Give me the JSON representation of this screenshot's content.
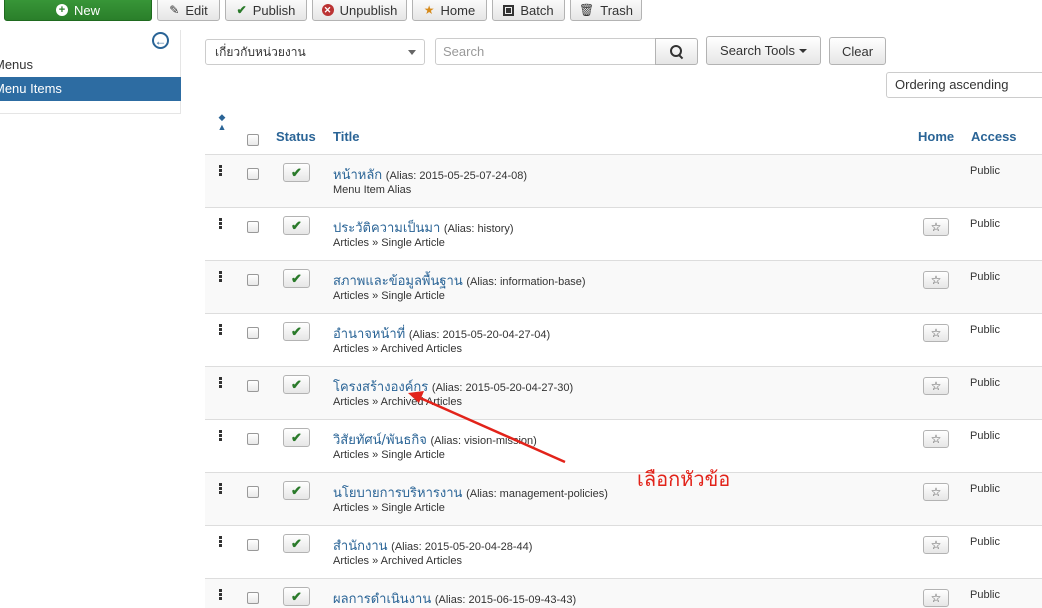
{
  "toolbar": {
    "new_label": "New",
    "edit_label": "Edit",
    "publish_label": "Publish",
    "unpublish_label": "Unpublish",
    "home_label": "Home",
    "batch_label": "Batch",
    "trash_label": "Trash"
  },
  "sidebar": {
    "items": [
      {
        "label": "Menus",
        "active": false
      },
      {
        "label": "Menu Items",
        "active": true
      }
    ]
  },
  "filters": {
    "menu_select_value": "เกี่ยวกับหน่วยงาน",
    "search_placeholder": "Search",
    "search_tools_label": "Search Tools",
    "clear_label": "Clear",
    "ordering_value": "Ordering ascending"
  },
  "table": {
    "headers": {
      "status": "Status",
      "title": "Title",
      "home": "Home",
      "access": "Access"
    },
    "rows": [
      {
        "title": "หน้าหลัก",
        "alias": "(Alias: 2015-05-25-07-24-08)",
        "type": "Menu Item Alias",
        "access": "Public",
        "has_home": false
      },
      {
        "title": "ประวัติความเป็นมา",
        "alias": "(Alias: history)",
        "type": "Articles » Single Article",
        "access": "Public",
        "has_home": true
      },
      {
        "title": "สภาพและข้อมูลพื้นฐาน",
        "alias": "(Alias: information-base)",
        "type": "Articles » Single Article",
        "access": "Public",
        "has_home": true
      },
      {
        "title": "อำนาจหน้าที่",
        "alias": "(Alias: 2015-05-20-04-27-04)",
        "type": "Articles » Archived Articles",
        "access": "Public",
        "has_home": true
      },
      {
        "title": "โครงสร้างองค์กร",
        "alias": "(Alias: 2015-05-20-04-27-30)",
        "type": "Articles » Archived Articles",
        "access": "Public",
        "has_home": true
      },
      {
        "title": "วิสัยทัศน์/พันธกิจ",
        "alias": "(Alias: vision-mission)",
        "type": "Articles » Single Article",
        "access": "Public",
        "has_home": true
      },
      {
        "title": "นโยบายการบริหารงาน",
        "alias": "(Alias: management-policies)",
        "type": "Articles » Single Article",
        "access": "Public",
        "has_home": true
      },
      {
        "title": "สำนักงาน",
        "alias": "(Alias: 2015-05-20-04-28-44)",
        "type": "Articles » Archived Articles",
        "access": "Public",
        "has_home": true
      },
      {
        "title": "ผลการดำเนินงาน",
        "alias": "(Alias: 2015-06-15-09-43-43)",
        "type": "",
        "access": "Public",
        "has_home": true
      }
    ]
  },
  "annotation": {
    "text": "เลือกหัวข้อ",
    "color": "#e2231a"
  },
  "colors": {
    "link": "#2a6496",
    "active_sidebar": "#2d6ca2",
    "new_button": "#2f8a2f"
  }
}
